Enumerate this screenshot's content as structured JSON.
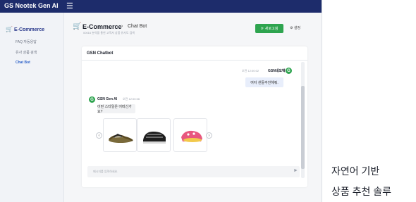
{
  "app": {
    "brand": "GS Neotek Gen AI",
    "menu_icon": "hamburger-icon"
  },
  "sidebar": {
    "section": {
      "label": "E-Commerce",
      "icon": "cart-icon"
    },
    "items": [
      {
        "label": "FAQ 자동응답"
      },
      {
        "label": "유사 상품 검색"
      },
      {
        "label": "Chat Bot"
      }
    ]
  },
  "header": {
    "title": "E-Commerce",
    "separator": "›",
    "crumb": "Chat Bot",
    "subtitle": "00016 분석을 통한 고객서 상품 유사도 검색",
    "new_chat": "새로고침",
    "settings": "설정"
  },
  "chat": {
    "title": "GSN Chatbot",
    "user": {
      "time": "오전 12:00:02",
      "name": "GSN네오텍",
      "avatar": "G",
      "message": "여자 샌들추천해줘."
    },
    "bot": {
      "name": "GSN Gen AI",
      "time": "오전 12:00:06",
      "avatar": "G",
      "message": "어떤 스타일은 어떠신가요?"
    },
    "products": [
      {
        "name": "flat-sandal"
      },
      {
        "name": "strap-sandal"
      },
      {
        "name": "pink-shoe"
      }
    ],
    "input_placeholder": "메시지를 입력하세요."
  },
  "caption": {
    "line1": "자연어 기반",
    "line2": "상품 추천 솔루"
  },
  "colors": {
    "navy": "#1d2c6b",
    "accent_green": "#2ea44f",
    "active_blue": "#2f63c9"
  }
}
